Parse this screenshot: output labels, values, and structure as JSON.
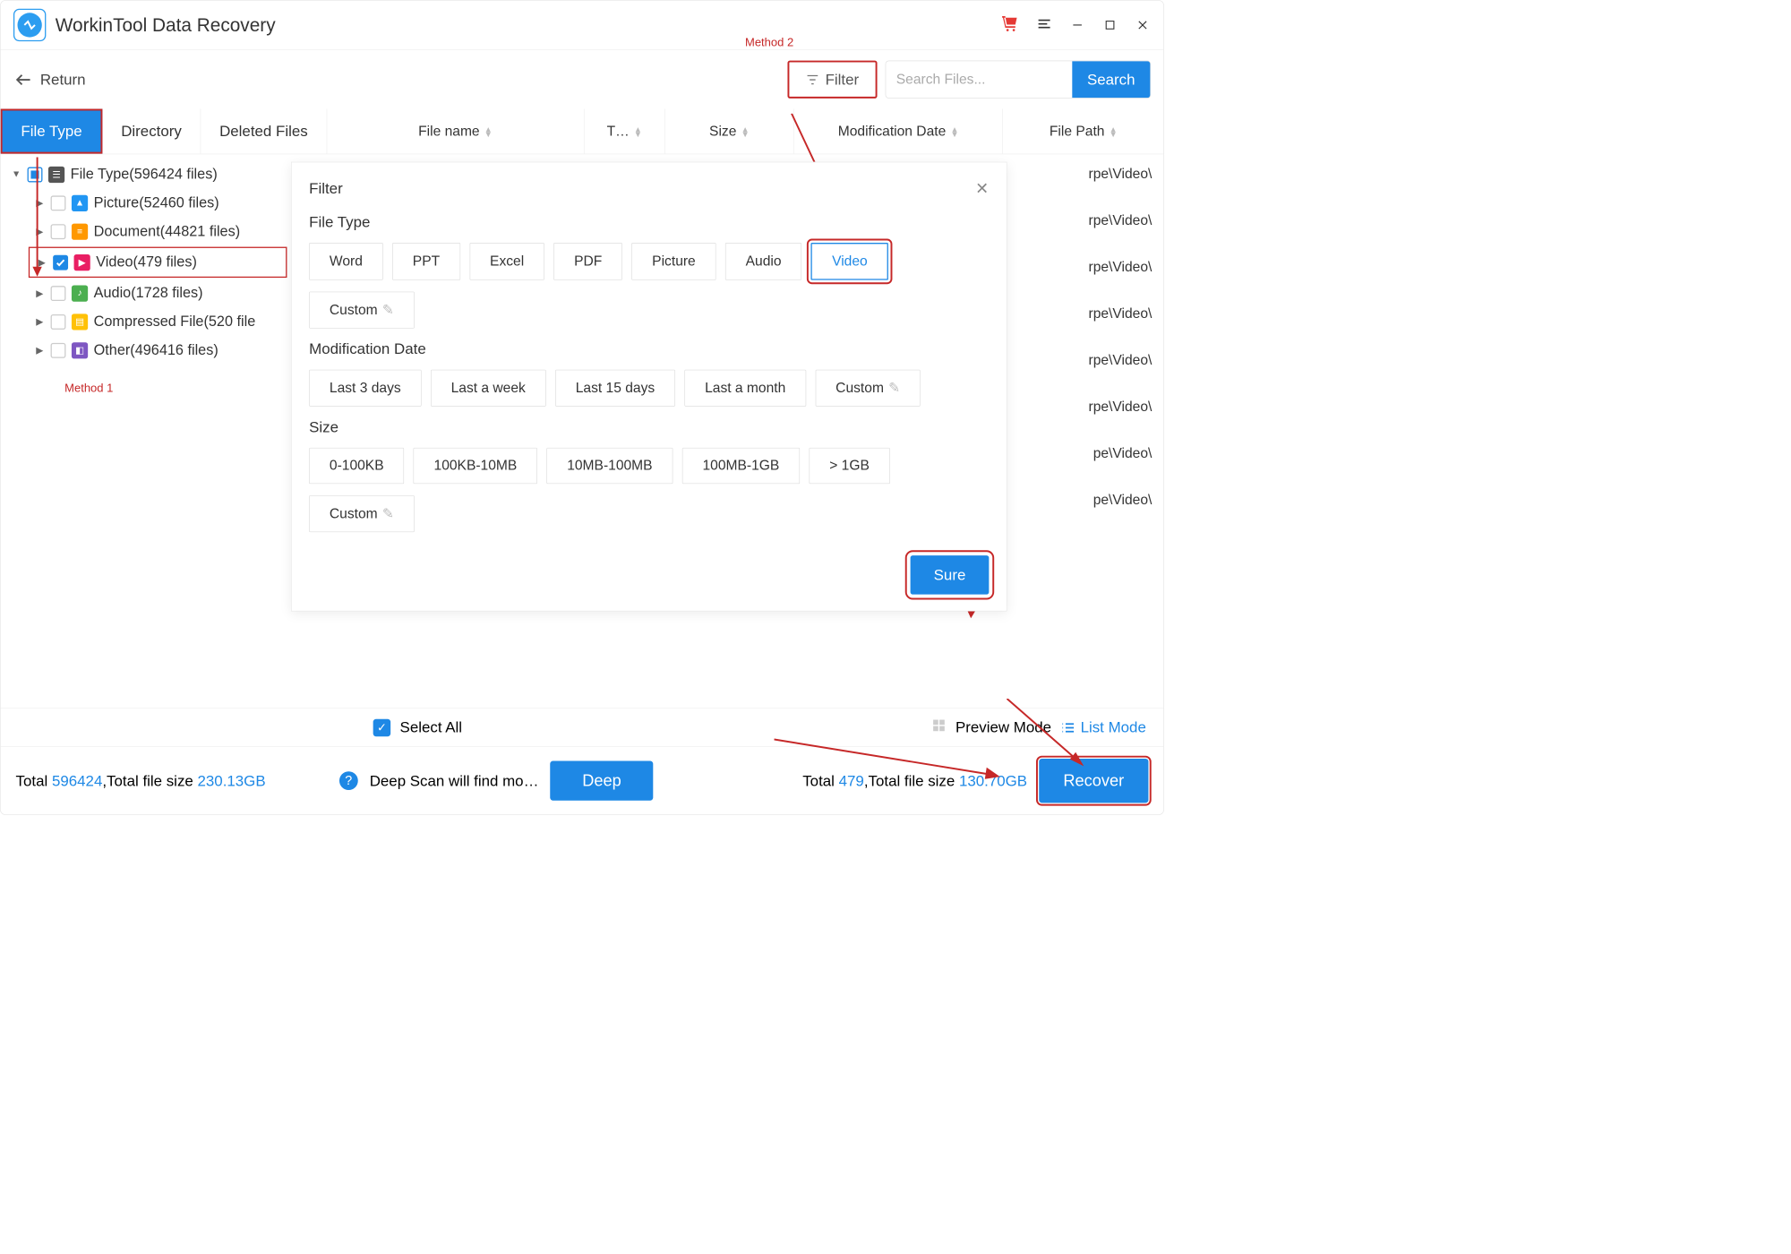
{
  "title": "WorkinTool Data Recovery",
  "toolbar": {
    "return": "Return",
    "filter": "Filter",
    "search_placeholder": "Search Files...",
    "search_btn": "Search"
  },
  "annotations": {
    "method1": "Method 1",
    "method2": "Method 2"
  },
  "tabs": {
    "file_type": "File Type",
    "directory": "Directory",
    "deleted": "Deleted Files"
  },
  "columns": {
    "filename": "File name",
    "t": "T…",
    "size": "Size",
    "moddate": "Modification Date",
    "path": "File Path"
  },
  "tree": {
    "root": "File Type(596424 files)",
    "picture": "Picture(52460 files)",
    "document": "Document(44821 files)",
    "video": "Video(479 files)",
    "audio": "Audio(1728 files)",
    "compressed": "Compressed File(520 file",
    "other": "Other(496416 files)"
  },
  "path_cell": "pe\\Video\\",
  "path_cell_alt": "rpe\\Video\\",
  "filter_popup": {
    "title": "Filter",
    "section_type": "File Type",
    "types": {
      "word": "Word",
      "ppt": "PPT",
      "excel": "Excel",
      "pdf": "PDF",
      "picture": "Picture",
      "audio": "Audio",
      "video": "Video",
      "custom": "Custom"
    },
    "section_date": "Modification Date",
    "dates": {
      "d3": "Last 3 days",
      "week": "Last a week",
      "d15": "Last 15 days",
      "month": "Last a month",
      "custom": "Custom"
    },
    "section_size": "Size",
    "sizes": {
      "s1": "0-100KB",
      "s2": "100KB-10MB",
      "s3": "10MB-100MB",
      "s4": "100MB-1GB",
      "s5": "> 1GB",
      "custom": "Custom"
    },
    "sure": "Sure"
  },
  "modebar": {
    "select_all": "Select All",
    "preview": "Preview Mode",
    "list": "List Mode"
  },
  "status": {
    "total_label": "Total ",
    "total_count": "596424",
    "total_mid": ",Total file size ",
    "total_size": "230.13GB",
    "deep_hint": "Deep Scan will find mo…",
    "deep_btn": "Deep",
    "filtered_label": "Total ",
    "filtered_count": "479",
    "filtered_mid": ",Total file size ",
    "filtered_size": "130.70GB",
    "recover": "Recover"
  }
}
